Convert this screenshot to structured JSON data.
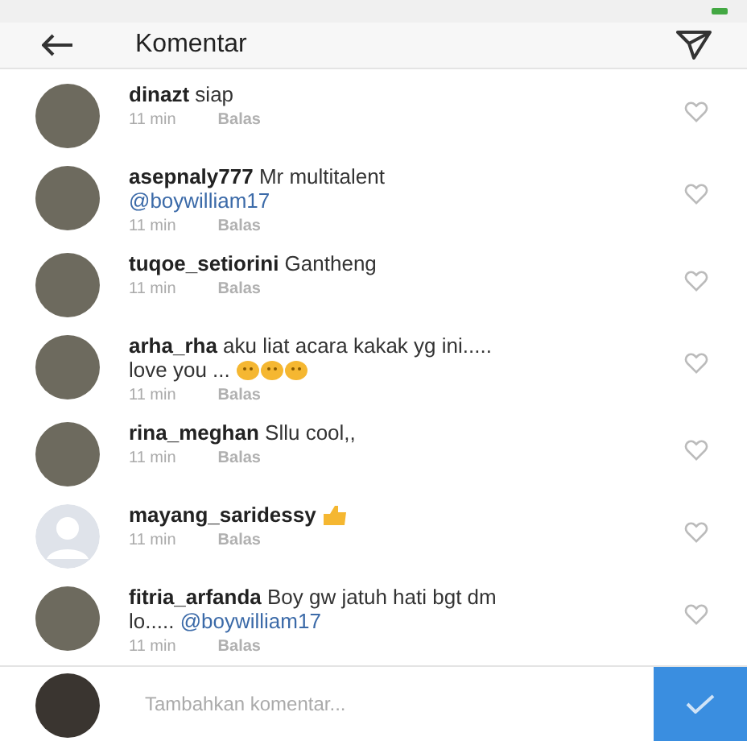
{
  "header": {
    "title": "Komentar"
  },
  "comments": [
    {
      "default_avatar": false,
      "user": "dinazt",
      "text": "siap",
      "time": "11 min",
      "reply": "Balas"
    },
    {
      "default_avatar": false,
      "user": "asepnaly777",
      "text": "Mr multitalent",
      "mention": "@boywilliam17",
      "time": "11 min",
      "reply": "Balas"
    },
    {
      "default_avatar": false,
      "user": "tuqoe_setiorini",
      "text": "Gantheng",
      "time": "11 min",
      "reply": "Balas"
    },
    {
      "default_avatar": false,
      "user": "arha_rha",
      "text": "aku liat acara kakak yg ini..... love you ...",
      "emojis": [
        {
          "kind": "smiley"
        },
        {
          "kind": "smiley"
        },
        {
          "kind": "smiley"
        }
      ],
      "time": "11 min",
      "reply": "Balas"
    },
    {
      "default_avatar": false,
      "user": "rina_meghan",
      "text": "Sllu cool,,",
      "time": "11 min",
      "reply": "Balas"
    },
    {
      "default_avatar": true,
      "user": "mayang_saridessy",
      "emojis": [
        {
          "kind": "thumb"
        }
      ],
      "time": "11 min",
      "reply": "Balas"
    },
    {
      "default_avatar": false,
      "user": "fitria_arfanda",
      "text": "Boy gw jatuh hati bgt dm lo.....",
      "mention": "@boywilliam17",
      "time": "11 min",
      "reply": "Balas"
    }
  ],
  "composer": {
    "placeholder": "Tambahkan komentar..."
  }
}
